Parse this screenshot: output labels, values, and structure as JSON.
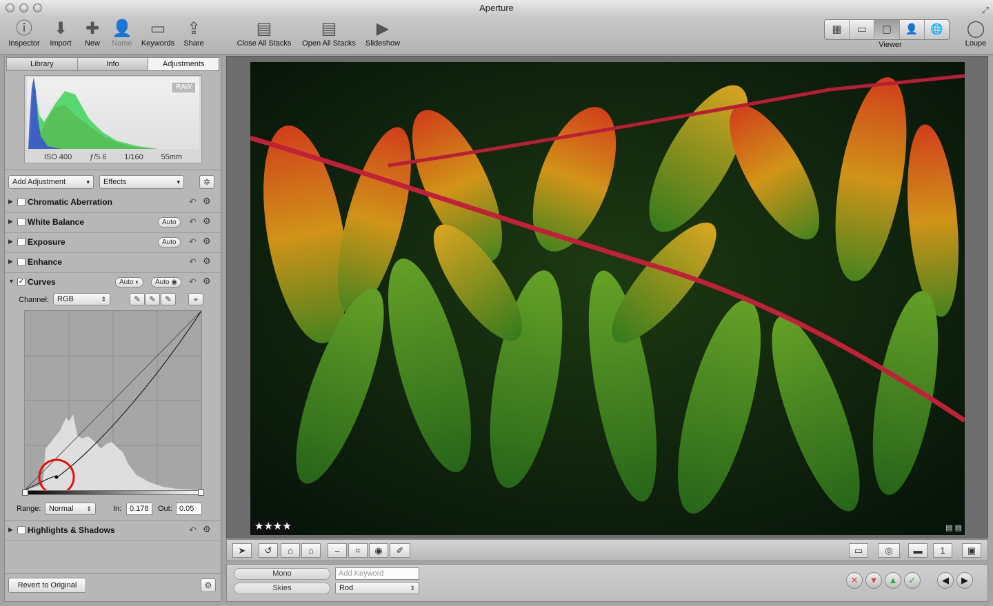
{
  "window": {
    "title": "Aperture"
  },
  "toolbar": {
    "inspector": "Inspector",
    "import": "Import",
    "new": "New",
    "name": "Name",
    "keywords": "Keywords",
    "share": "Share",
    "close_all_stacks": "Close All Stacks",
    "open_all_stacks": "Open All Stacks",
    "slideshow": "Slideshow",
    "viewer": "Viewer",
    "loupe": "Loupe"
  },
  "inspector_tabs": [
    "Library",
    "Info",
    "Adjustments"
  ],
  "histogram": {
    "badge": "RAW",
    "iso": "ISO 400",
    "aperture": "ƒ/5.6",
    "shutter": "1/160",
    "focal": "55mm"
  },
  "adjust_controls": {
    "add_adjustment": "Add Adjustment",
    "effects": "Effects"
  },
  "bricks": {
    "chromatic": "Chromatic Aberration",
    "white_balance": "White Balance",
    "exposure": "Exposure",
    "enhance": "Enhance",
    "curves": "Curves",
    "highlights": "Highlights & Shadows",
    "auto": "Auto"
  },
  "curves": {
    "channel_label": "Channel:",
    "channel": "RGB",
    "range_label": "Range:",
    "range": "Normal",
    "in_label": "In:",
    "in": "0.178",
    "out_label": "Out:",
    "out": "0.05"
  },
  "revert": "Revert to Original",
  "photo": {
    "rating": "★★★★"
  },
  "metadata": {
    "preset1": "Mono",
    "preset2": "Skies",
    "keyword_placeholder": "Add Keyword",
    "keyword_set": "Rod"
  },
  "colors": {
    "reject": "#d44",
    "accept": "#3a3"
  }
}
